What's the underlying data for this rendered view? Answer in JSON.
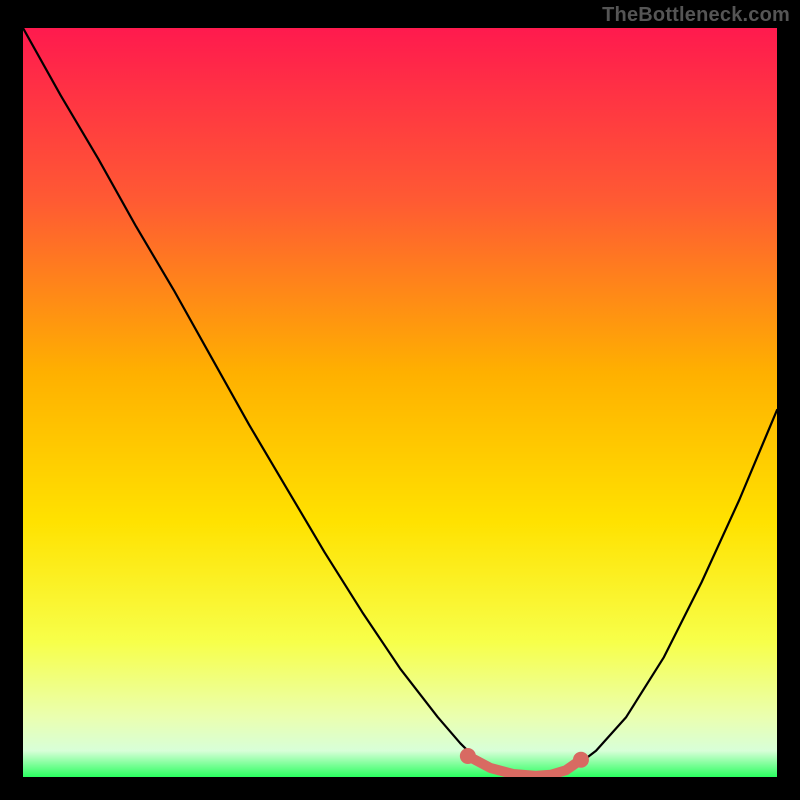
{
  "watermark": "TheBottleneck.com",
  "colors": {
    "page_bg": "#000000",
    "gradient_top": "#ff1a4e",
    "gradient_mid_upper": "#ff6a2a",
    "gradient_mid": "#ffd400",
    "gradient_lower": "#f7ff4a",
    "gradient_pale": "#f5ffd0",
    "gradient_bottom": "#2aff60",
    "curve": "#000000",
    "marker_fill": "#d86a62",
    "marker_stroke": "#d86a62"
  },
  "chart_data": {
    "type": "line",
    "title": "",
    "xlabel": "",
    "ylabel": "",
    "xlim": [
      0,
      100
    ],
    "ylim": [
      0,
      100
    ],
    "series": [
      {
        "name": "bottleneck-curve",
        "x": [
          0,
          5,
          10,
          15,
          20,
          25,
          30,
          35,
          40,
          45,
          50,
          55,
          58,
          60,
          62,
          65,
          68,
          70,
          73,
          76,
          80,
          85,
          90,
          95,
          100
        ],
        "y": [
          100,
          91,
          82.5,
          73.5,
          65,
          56,
          47,
          38.5,
          30,
          22,
          14.5,
          8,
          4.5,
          2.5,
          1.2,
          0.4,
          0.15,
          0.3,
          1.2,
          3.5,
          8,
          16,
          26,
          37,
          49
        ]
      }
    ],
    "highlight_segment": {
      "name": "optimal-range",
      "x": [
        59,
        62,
        65,
        68,
        70,
        72,
        74
      ],
      "y": [
        2.8,
        1.2,
        0.4,
        0.15,
        0.3,
        0.9,
        2.3
      ]
    },
    "highlight_points": [
      {
        "x": 59,
        "y": 2.8
      },
      {
        "x": 74,
        "y": 2.3
      }
    ]
  }
}
